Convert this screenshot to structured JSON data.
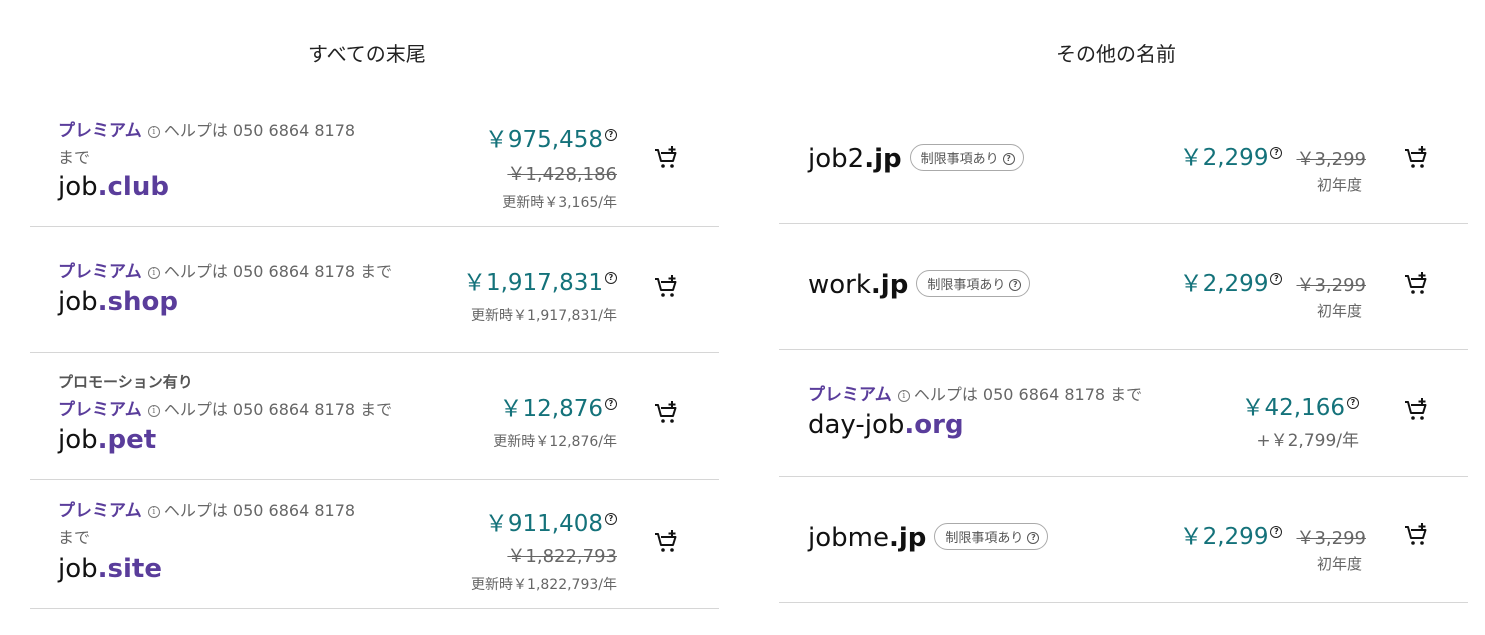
{
  "sections": {
    "all_tlds_title": "すべての末尾",
    "other_names_title": "その他の名前"
  },
  "left": [
    {
      "premium": "プレミアム",
      "help": "ヘルプは 050 6864 8178",
      "help2": "まで",
      "name": "job",
      "tld": ".club",
      "price": "￥975,458",
      "old": "￥1,428,186",
      "renew": "更新時￥3,165/年"
    },
    {
      "premium": "プレミアム",
      "help": "ヘルプは 050 6864 8178 まで",
      "name": "job",
      "tld": ".shop",
      "price": "￥1,917,831",
      "renew": "更新時￥1,917,831/年"
    },
    {
      "promo": "プロモーション有り",
      "premium": "プレミアム",
      "help": "ヘルプは 050 6864 8178 まで",
      "name": "job",
      "tld": ".pet",
      "price": "￥12,876",
      "renew": "更新時￥12,876/年"
    },
    {
      "premium": "プレミアム",
      "help": "ヘルプは 050 6864 8178",
      "help2": "まで",
      "name": "job",
      "tld": ".site",
      "price": "￥911,408",
      "old": "￥1,822,793",
      "renew": "更新時￥1,822,793/年"
    }
  ],
  "right": [
    {
      "name": "job2",
      "tld": ".jp",
      "badge": "制限事項あり",
      "price": "￥2,299",
      "old": "￥3,299",
      "sub": "初年度"
    },
    {
      "name": "work",
      "tld": ".jp",
      "badge": "制限事項あり",
      "price": "￥2,299",
      "old": "￥3,299",
      "sub": "初年度"
    },
    {
      "premium": "プレミアム",
      "help": "ヘルプは 050 6864 8178 まで",
      "name": "day-job",
      "tld": ".org",
      "price": "￥42,166",
      "sub": "+￥2,799/年"
    },
    {
      "name": "jobme",
      "tld": ".jp",
      "badge": "制限事項あり",
      "price": "￥2,299",
      "old": "￥3,299",
      "sub": "初年度"
    }
  ],
  "icons": {
    "info": "info-icon",
    "help": "question-circle-icon",
    "cart": "add-to-cart-icon"
  },
  "colors": {
    "premium": "#5a3d9b",
    "price": "#14727a",
    "divider": "#d6d6d6"
  }
}
